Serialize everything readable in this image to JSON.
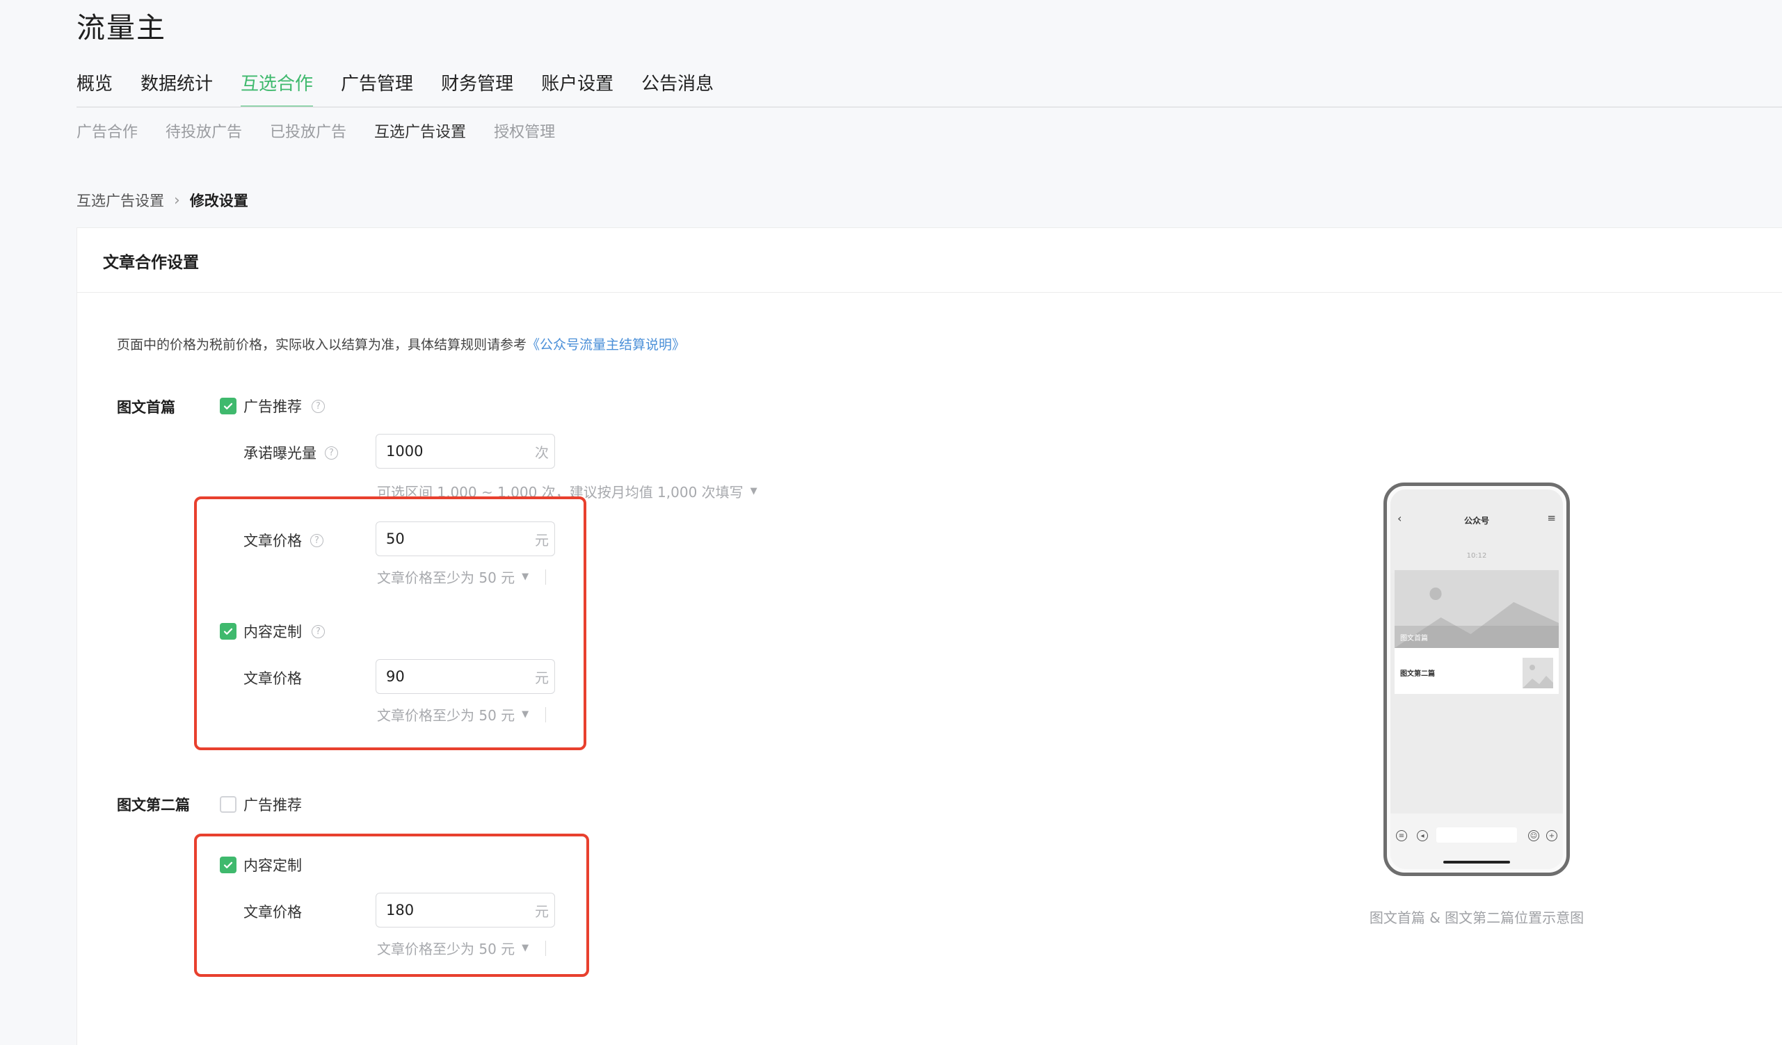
{
  "app": {
    "title": "流量主"
  },
  "main_nav": [
    {
      "label": "概览",
      "active": false
    },
    {
      "label": "数据统计",
      "active": false
    },
    {
      "label": "互选合作",
      "active": true
    },
    {
      "label": "广告管理",
      "active": false
    },
    {
      "label": "财务管理",
      "active": false
    },
    {
      "label": "账户设置",
      "active": false
    },
    {
      "label": "公告消息",
      "active": false
    }
  ],
  "sub_nav": [
    {
      "label": "广告合作",
      "active": false
    },
    {
      "label": "待投放广告",
      "active": false
    },
    {
      "label": "已投放广告",
      "active": false
    },
    {
      "label": "互选广告设置",
      "active": true
    },
    {
      "label": "授权管理",
      "active": false
    }
  ],
  "breadcrumb": {
    "parent": "互选广告设置",
    "current": "修改设置"
  },
  "card": {
    "title": "文章合作设置"
  },
  "notice": {
    "text": "页面中的价格为税前价格，实际收入以结算为准，具体结算规则请参考",
    "link": "《公众号流量主结算说明》"
  },
  "first_article": {
    "label": "图文首篇",
    "ad_recommend": {
      "label": "广告推荐",
      "checked": true
    },
    "exposure": {
      "label": "承诺曝光量",
      "value": "1000",
      "unit": "次",
      "hint": "可选区间 1,000 ~ 1,000 次，建议按月均值 1,000 次填写"
    },
    "ad_price": {
      "label": "文章价格",
      "value": "50",
      "unit": "元",
      "hint": "文章价格至少为 50 元"
    },
    "custom": {
      "label": "内容定制",
      "checked": true
    },
    "custom_price": {
      "label": "文章价格",
      "value": "90",
      "unit": "元",
      "hint": "文章价格至少为 50 元"
    }
  },
  "second_article": {
    "label": "图文第二篇",
    "ad_recommend": {
      "label": "广告推荐",
      "checked": false
    },
    "custom": {
      "label": "内容定制",
      "checked": true
    },
    "custom_price": {
      "label": "文章价格",
      "value": "180",
      "unit": "元",
      "hint": "文章价格至少为 50 元"
    }
  },
  "preview": {
    "account": "公众号",
    "time": "10:12",
    "first_label": "图文首篇",
    "second_label": "图文第二篇",
    "caption": "图文首篇 & 图文第二篇位置示意图"
  },
  "colors": {
    "accent": "#3fb96d",
    "highlight": "#e8402e",
    "link": "#4a8fd8"
  },
  "icons": {
    "checkbox": "check-icon",
    "help": "question-circle-icon",
    "dropdown": "caret-down-icon",
    "breadcrumb_sep": "chevron-right-icon"
  }
}
